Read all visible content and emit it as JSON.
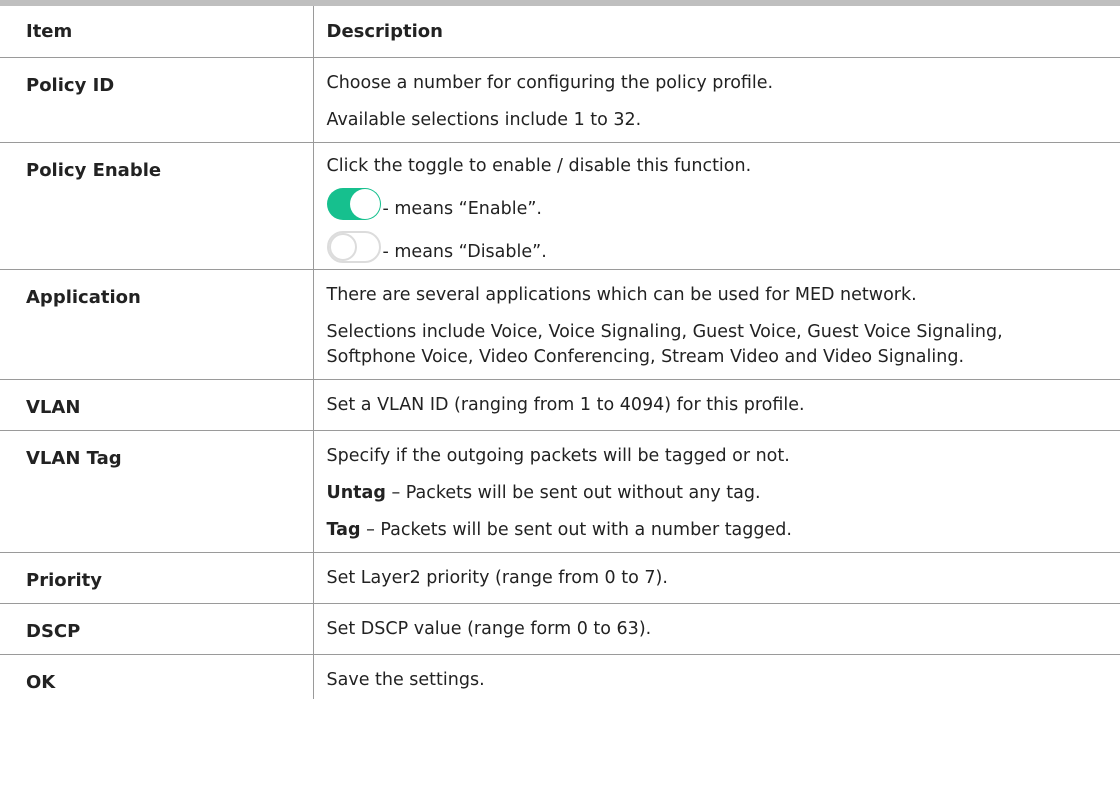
{
  "header": {
    "item": "Item",
    "description": "Description"
  },
  "rows": [
    {
      "item": "Policy ID",
      "lines": [
        "Choose a number for configuring the policy profile.",
        "Available selections include 1 to 32."
      ]
    },
    {
      "item": "Policy Enable",
      "lines": [
        "Click the toggle to enable / disable this function."
      ],
      "toggles": [
        {
          "state": "on",
          "text": "- means “Enable”."
        },
        {
          "state": "off",
          "text": "- means “Disable”."
        }
      ]
    },
    {
      "item": "Application",
      "lines": [
        "There are several applications which can be used for MED network.",
        "Selections include Voice, Voice Signaling, Guest Voice, Guest Voice Signaling, Softphone Voice, Video Conferencing, Stream Video and Video Signaling."
      ]
    },
    {
      "item": "VLAN",
      "lines": [
        "Set a VLAN ID (ranging from 1 to 4094) for this profile."
      ]
    },
    {
      "item": "VLAN Tag",
      "lines": [
        "Specify if the outgoing packets will be tagged or not."
      ],
      "options": [
        {
          "term": "Untag",
          "text": " – Packets will be sent out without any tag."
        },
        {
          "term": "Tag",
          "text": " – Packets will be sent out with a number tagged."
        }
      ]
    },
    {
      "item": "Priority",
      "lines": [
        "Set Layer2 priority (range from 0 to 7)."
      ]
    },
    {
      "item": "DSCP",
      "lines": [
        "Set DSCP value (range form 0 to 63)."
      ]
    },
    {
      "item": "OK",
      "lines": [
        "Save the settings."
      ]
    }
  ],
  "colors": {
    "toggle_on": "#16c08e",
    "toggle_off_border": "#dcdcdc",
    "rule": "#bfbfbf",
    "grid": "#9a9a9a"
  }
}
